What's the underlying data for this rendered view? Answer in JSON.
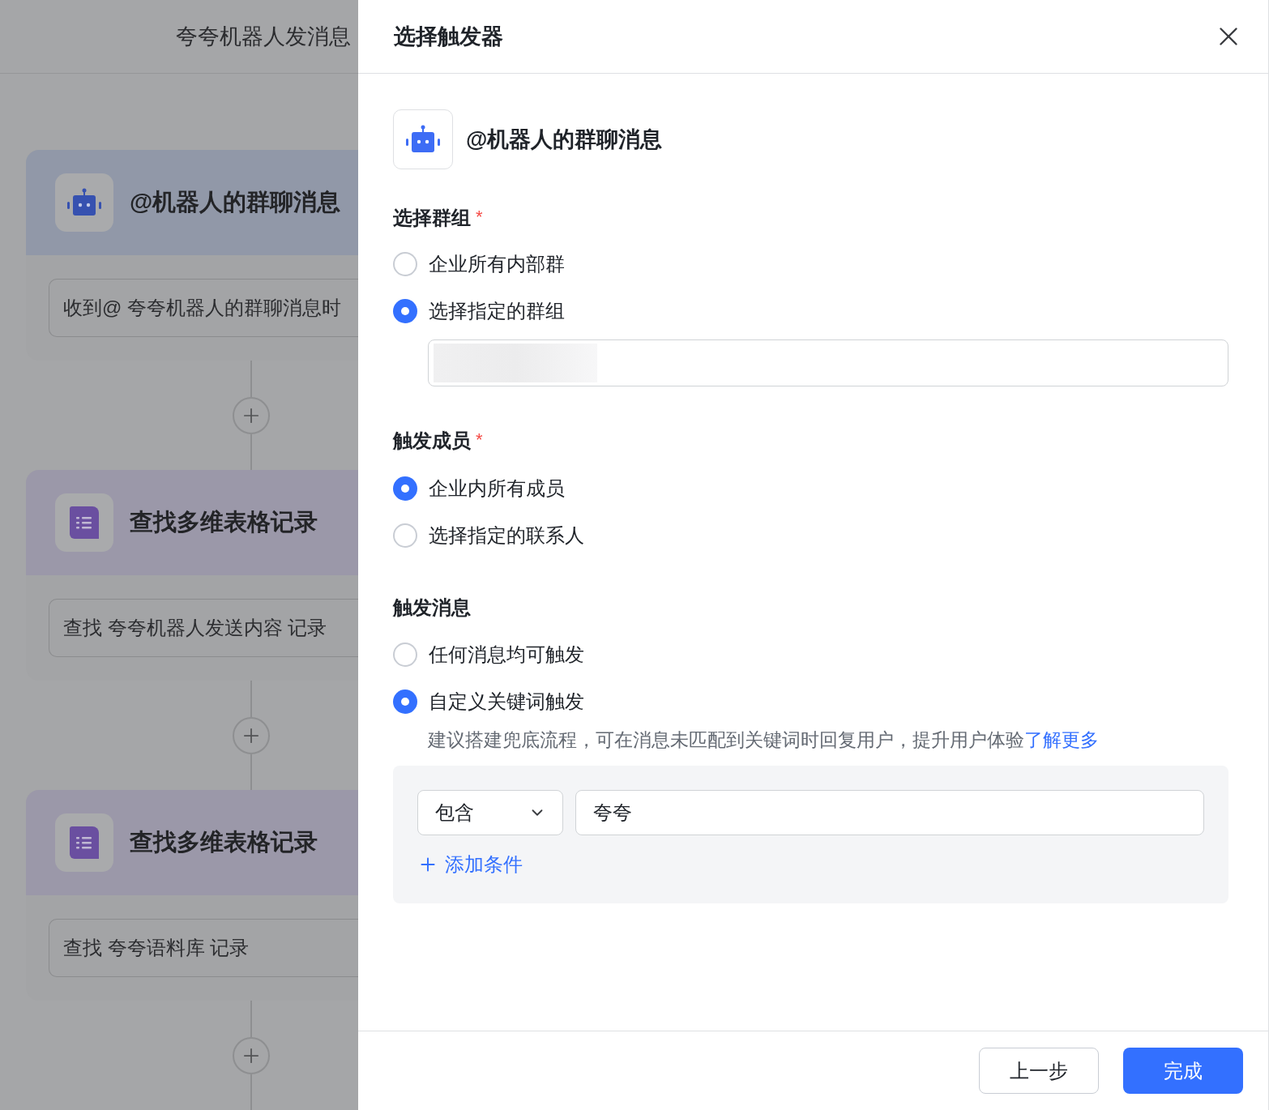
{
  "canvas": {
    "title": "夸夸机器人发消息",
    "nodes": [
      {
        "kind": "robot",
        "title": "@机器人的群聊消息",
        "summary": "收到@ 夸夸机器人的群聊消息时"
      },
      {
        "kind": "table",
        "title": "查找多维表格记录",
        "summary": "查找 夸夸机器人发送内容 记录"
      },
      {
        "kind": "table",
        "title": "查找多维表格记录",
        "summary": "查找 夸夸语料库 记录"
      }
    ]
  },
  "drawer": {
    "title": "选择触发器",
    "trigger": {
      "kind": "robot",
      "title": "@机器人的群聊消息"
    },
    "group_section": {
      "title": "选择群组",
      "required_mark": "*",
      "options": [
        {
          "label": "企业所有内部群",
          "selected": false
        },
        {
          "label": "选择指定的群组",
          "selected": true
        }
      ]
    },
    "member_section": {
      "title": "触发成员",
      "required_mark": "*",
      "options": [
        {
          "label": "企业内所有成员",
          "selected": true
        },
        {
          "label": "选择指定的联系人",
          "selected": false
        }
      ]
    },
    "message_section": {
      "title": "触发消息",
      "options": [
        {
          "label": "任何消息均可触发",
          "selected": false
        },
        {
          "label": "自定义关键词触发",
          "selected": true
        }
      ],
      "hint": "建议搭建兜底流程，可在消息未匹配到关键词时回复用户，提升用户体验",
      "hint_link": "了解更多",
      "conditions": [
        {
          "operator": "包含",
          "value": "夸夸"
        }
      ],
      "add_condition": "添加条件"
    },
    "buttons": [
      {
        "label": "上一步",
        "kind": "secondary"
      },
      {
        "label": "完成",
        "kind": "primary"
      }
    ]
  }
}
